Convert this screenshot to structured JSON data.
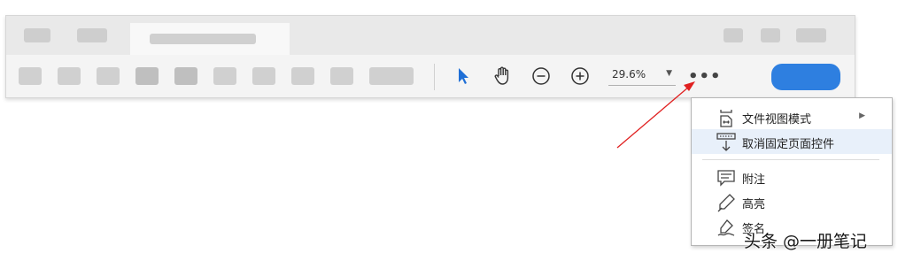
{
  "toolbar": {
    "zoom_value": "29.6%",
    "more_label": "•••",
    "tools": [
      "select-tool",
      "hand-tool",
      "zoom-out",
      "zoom-in"
    ]
  },
  "menu": {
    "items": [
      {
        "label": "文件视图模式",
        "has_submenu": true,
        "icon": "file-view-icon"
      },
      {
        "label": "取消固定页面控件",
        "highlighted": true,
        "icon": "unpin-controls-icon"
      },
      {
        "label": "附注",
        "icon": "comment-icon"
      },
      {
        "label": "高亮",
        "icon": "highlight-pen-icon"
      },
      {
        "label": "签名",
        "icon": "signature-icon"
      }
    ]
  },
  "watermark": "头条 @一册笔记",
  "colors": {
    "accent": "#2e7fe0",
    "arrow": "#e02020",
    "hover": "#e8f0fa"
  }
}
